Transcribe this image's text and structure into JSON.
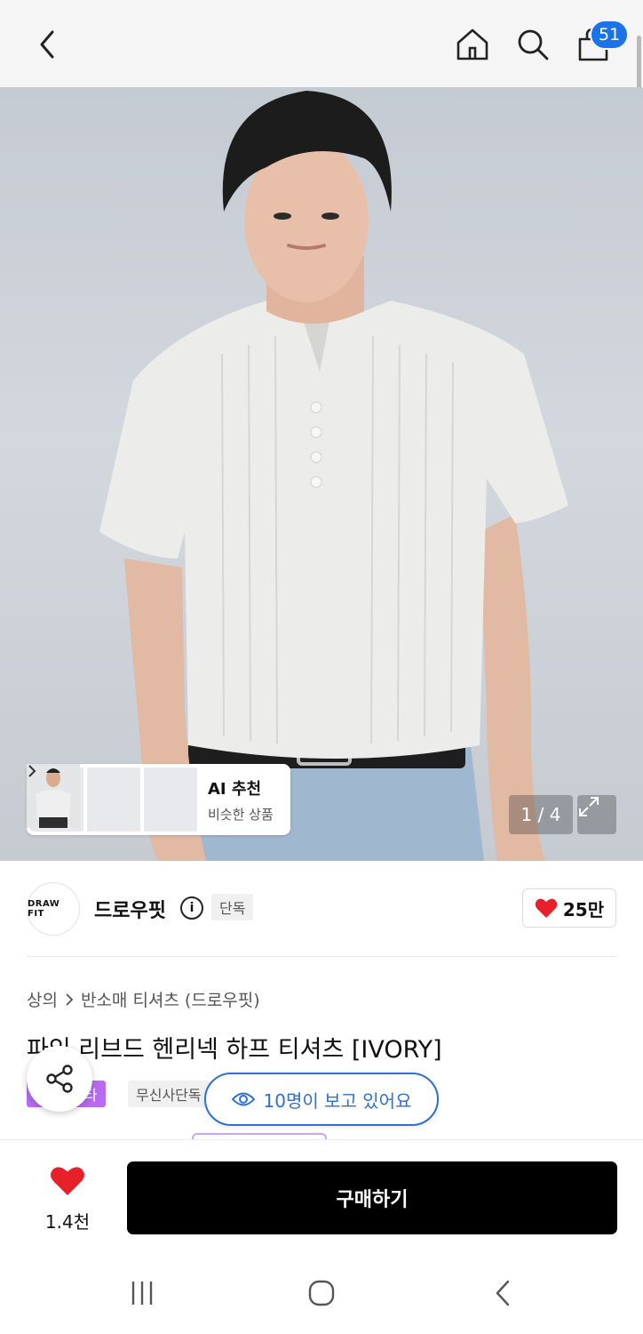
{
  "header": {
    "back_icon": "chevron-left-icon",
    "home_icon": "home-icon",
    "search_icon": "search-icon",
    "cart_icon": "shopping-bag-icon",
    "cart_count": "51"
  },
  "gallery": {
    "ai_recommend": {
      "title": "AI 추천",
      "subtitle": "비슷한 상품"
    },
    "pager": "1 / 4",
    "expand_icon": "expand-icon"
  },
  "brand": {
    "logo_text": "DRAW FIT",
    "name": "드로우핏",
    "info_icon": "info-icon",
    "badge": "단독",
    "likes": "25만"
  },
  "product": {
    "breadcrumb": [
      "상의",
      "반소매 티셔츠 (드로우핏)"
    ],
    "title": "파인 리브드 헨리넥 하프 티셔츠 [IVORY]",
    "tags": [
      "스타",
      "무신사단독"
    ],
    "viewers": "10명이 보고 있어요"
  },
  "bottom": {
    "wish_count": "1.4천",
    "buy_label": "구매하기"
  },
  "colors": {
    "accent_blue": "#1a73e8",
    "heart_red": "#e8202a",
    "purple_tag": "#b86bf2"
  }
}
